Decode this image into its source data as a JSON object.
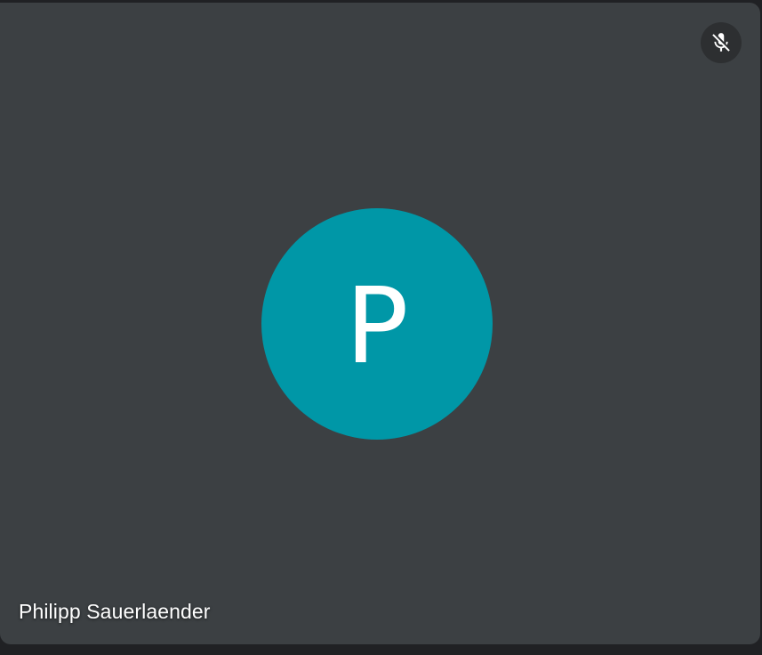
{
  "participant": {
    "name": "Philipp Sauerlaender",
    "initial": "P",
    "avatar_color": "#0097a7",
    "mic_status": "muted",
    "mic_icon": "mic-off-icon"
  },
  "colors": {
    "tile_background": "#3c4043",
    "page_background": "#202124",
    "text": "#ffffff"
  }
}
